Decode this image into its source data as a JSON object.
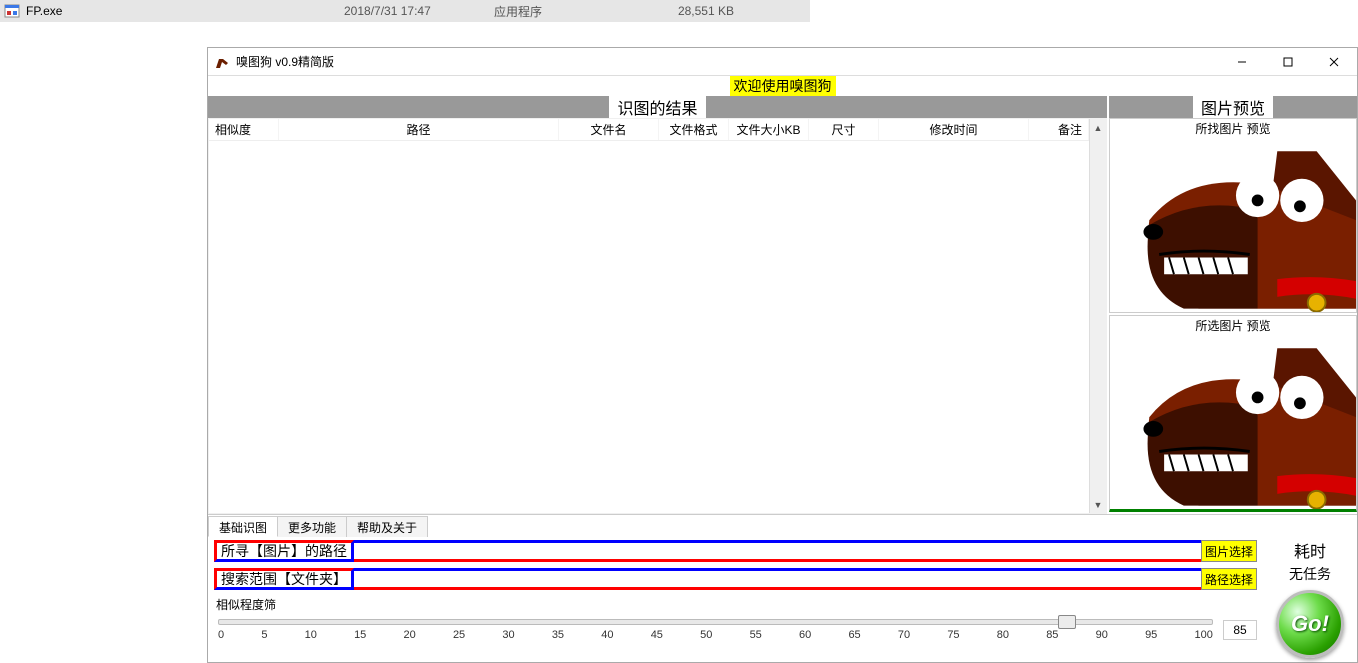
{
  "explorer_row": {
    "name": "FP.exe",
    "date": "2018/7/31 17:47",
    "type": "应用程序",
    "size": "28,551 KB"
  },
  "window": {
    "title": "嗅图狗 v0.9精简版",
    "banner": "欢迎使用嗅图狗",
    "results_header": "识图的结果",
    "preview_header": "图片预览",
    "columns": {
      "similarity": "相似度",
      "path": "路径",
      "filename": "文件名",
      "format": "文件格式",
      "size_kb": "文件大小KB",
      "dimensions": "尺寸",
      "mtime": "修改时间",
      "note": "备注"
    },
    "preview1_caption": "所找图片 预览",
    "preview2_caption": "所选图片 预览"
  },
  "tabs": {
    "basic": "基础识图",
    "more": "更多功能",
    "help": "帮助及关于"
  },
  "controls": {
    "image_path_label": "所寻【图片】的路径",
    "image_choose_btn": "图片选择",
    "folder_path_label": "搜索范围【文件夹】",
    "folder_choose_btn": "路径选择",
    "slider_title": "相似程度筛",
    "slider_ticks": [
      "0",
      "5",
      "10",
      "15",
      "20",
      "25",
      "30",
      "35",
      "40",
      "45",
      "50",
      "55",
      "60",
      "65",
      "70",
      "75",
      "80",
      "85",
      "90",
      "95",
      "100"
    ],
    "slider_value": "85"
  },
  "right_panel": {
    "timecost_label": "耗时",
    "timecost_value": "无任务",
    "go_label": "Go!"
  }
}
